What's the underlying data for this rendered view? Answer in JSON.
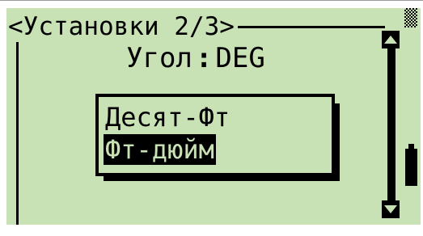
{
  "window": {
    "title": "<Установки 2/3>"
  },
  "settings": {
    "angle_label": "Угол",
    "separator": ":",
    "angle_value": "DEG"
  },
  "popup": {
    "options": [
      {
        "label": "Десят-Фт",
        "selected": false
      },
      {
        "label": "Фт-дюйм",
        "selected": true
      }
    ]
  },
  "indicators": {
    "screen_color": "#c8e2b6",
    "ink_color": "#000000",
    "scroll_up_icon": "triangle-up-icon",
    "scroll_down_icon": "triangle-down-icon",
    "battery_icon": "battery-icon",
    "signal_icon": "checker-pattern-icon"
  }
}
